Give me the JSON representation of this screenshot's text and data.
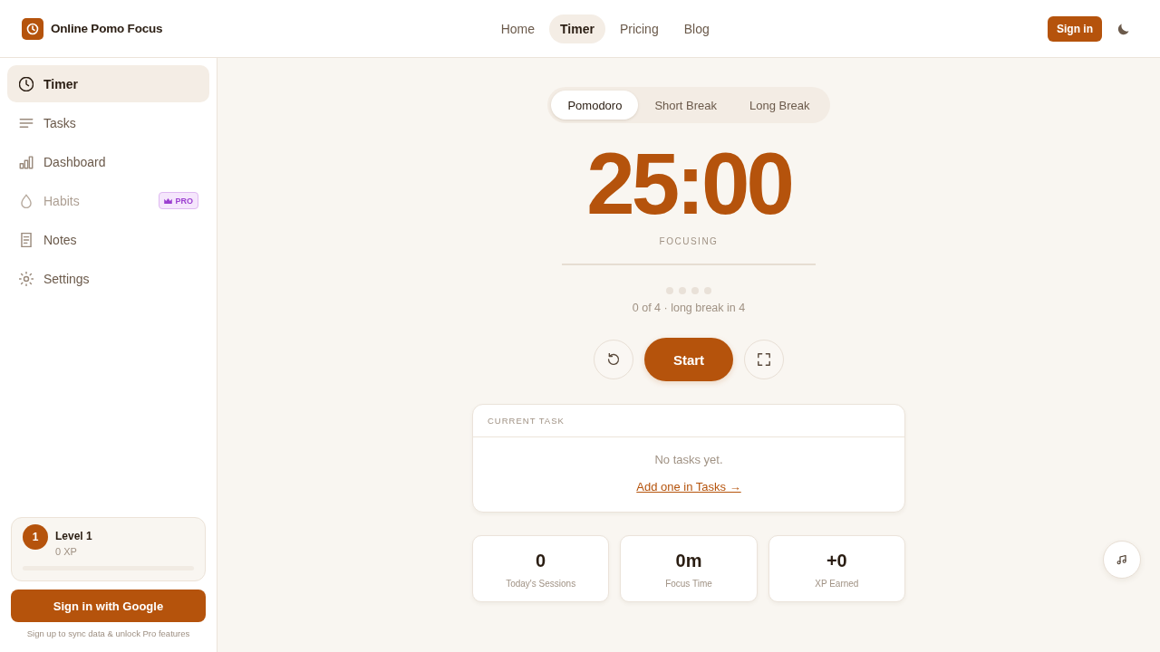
{
  "header": {
    "brand": "Online Pomo Focus",
    "nav": [
      {
        "label": "Home",
        "selected": false
      },
      {
        "label": "Timer",
        "selected": true
      },
      {
        "label": "Pricing",
        "selected": false
      },
      {
        "label": "Blog",
        "selected": false
      }
    ],
    "sign_in": "Sign in"
  },
  "sidebar": {
    "items": [
      {
        "label": "Timer",
        "selected": true,
        "disabled": false
      },
      {
        "label": "Tasks",
        "selected": false,
        "disabled": false
      },
      {
        "label": "Dashboard",
        "selected": false,
        "disabled": false
      },
      {
        "label": "Habits",
        "selected": false,
        "disabled": true,
        "badge": "PRO"
      },
      {
        "label": "Notes",
        "selected": false,
        "disabled": false
      },
      {
        "label": "Settings",
        "selected": false,
        "disabled": false
      }
    ],
    "level_card": {
      "badge": "1",
      "title": "Level 1",
      "xp": "0 XP",
      "level": 0
    },
    "google_button": "Sign in with Google",
    "note": "Sign up to sync data & unlock Pro features"
  },
  "timer": {
    "modes": [
      {
        "label": "Pomodoro",
        "selected": true
      },
      {
        "label": "Short Break",
        "selected": false
      },
      {
        "label": "Long Break",
        "selected": false
      }
    ],
    "time": "25:00",
    "status": "FOCUSING",
    "progress": {
      "level": 0
    },
    "sessions": [
      {
        "done": false
      },
      {
        "done": false
      },
      {
        "done": false
      },
      {
        "done": false
      }
    ],
    "session_text": "0 of 4 · long break in 4",
    "start_button": "Start"
  },
  "current_task": {
    "heading": "CURRENT TASK",
    "empty_text": "No tasks yet.",
    "link": "Add one in Tasks →"
  },
  "stats": [
    {
      "value": "0",
      "label": "Today's Sessions"
    },
    {
      "value": "0m",
      "label": "Focus Time"
    },
    {
      "value": "+0",
      "label": "XP Earned"
    }
  ]
}
